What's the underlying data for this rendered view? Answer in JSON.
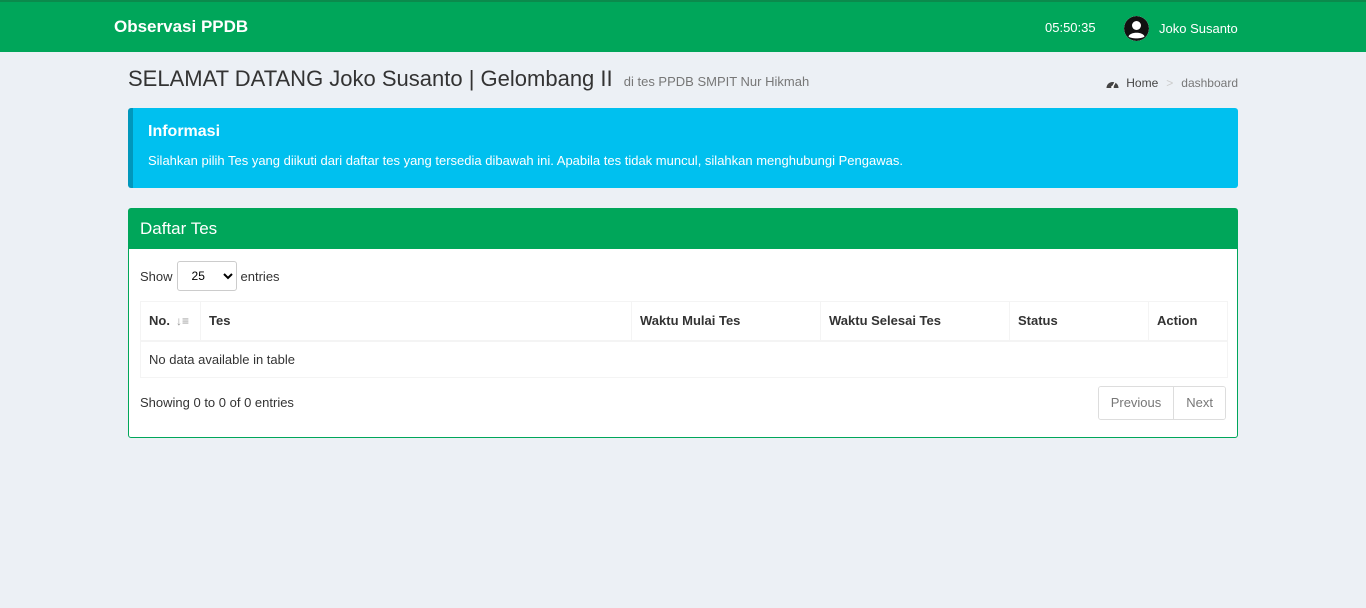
{
  "navbar": {
    "brand": "Observasi PPDB",
    "clock": "05:50:35",
    "user_name": "Joko Susanto",
    "user_icon": "user-circle-icon",
    "color": "#00a65a"
  },
  "page": {
    "title": "SELAMAT DATANG Joko Susanto | Gelombang II",
    "subtitle": "di tes PPDB SMPIT Nur Hikmah"
  },
  "breadcrumb": {
    "icon": "dashboard-icon",
    "home": "Home",
    "separator": ">",
    "current": "dashboard"
  },
  "callout": {
    "title": "Informasi",
    "text": "Silahkan pilih Tes yang diikuti dari daftar tes yang tersedia dibawah ini. Apabila tes tidak muncul, silahkan menghubungi Pengawas.",
    "color": "#00c0ef"
  },
  "box": {
    "title": "Daftar Tes",
    "show_label": "Show",
    "entries_label": "entries",
    "page_length": "25",
    "columns": [
      "No.",
      "Tes",
      "Waktu Mulai Tes",
      "Waktu Selesai Tes",
      "Status",
      "Action"
    ],
    "sort_icon": "sort-amount-down-icon",
    "empty_text": "No data available in table",
    "info": "Showing 0 to 0 of 0 entries",
    "previous": "Previous",
    "next": "Next"
  }
}
